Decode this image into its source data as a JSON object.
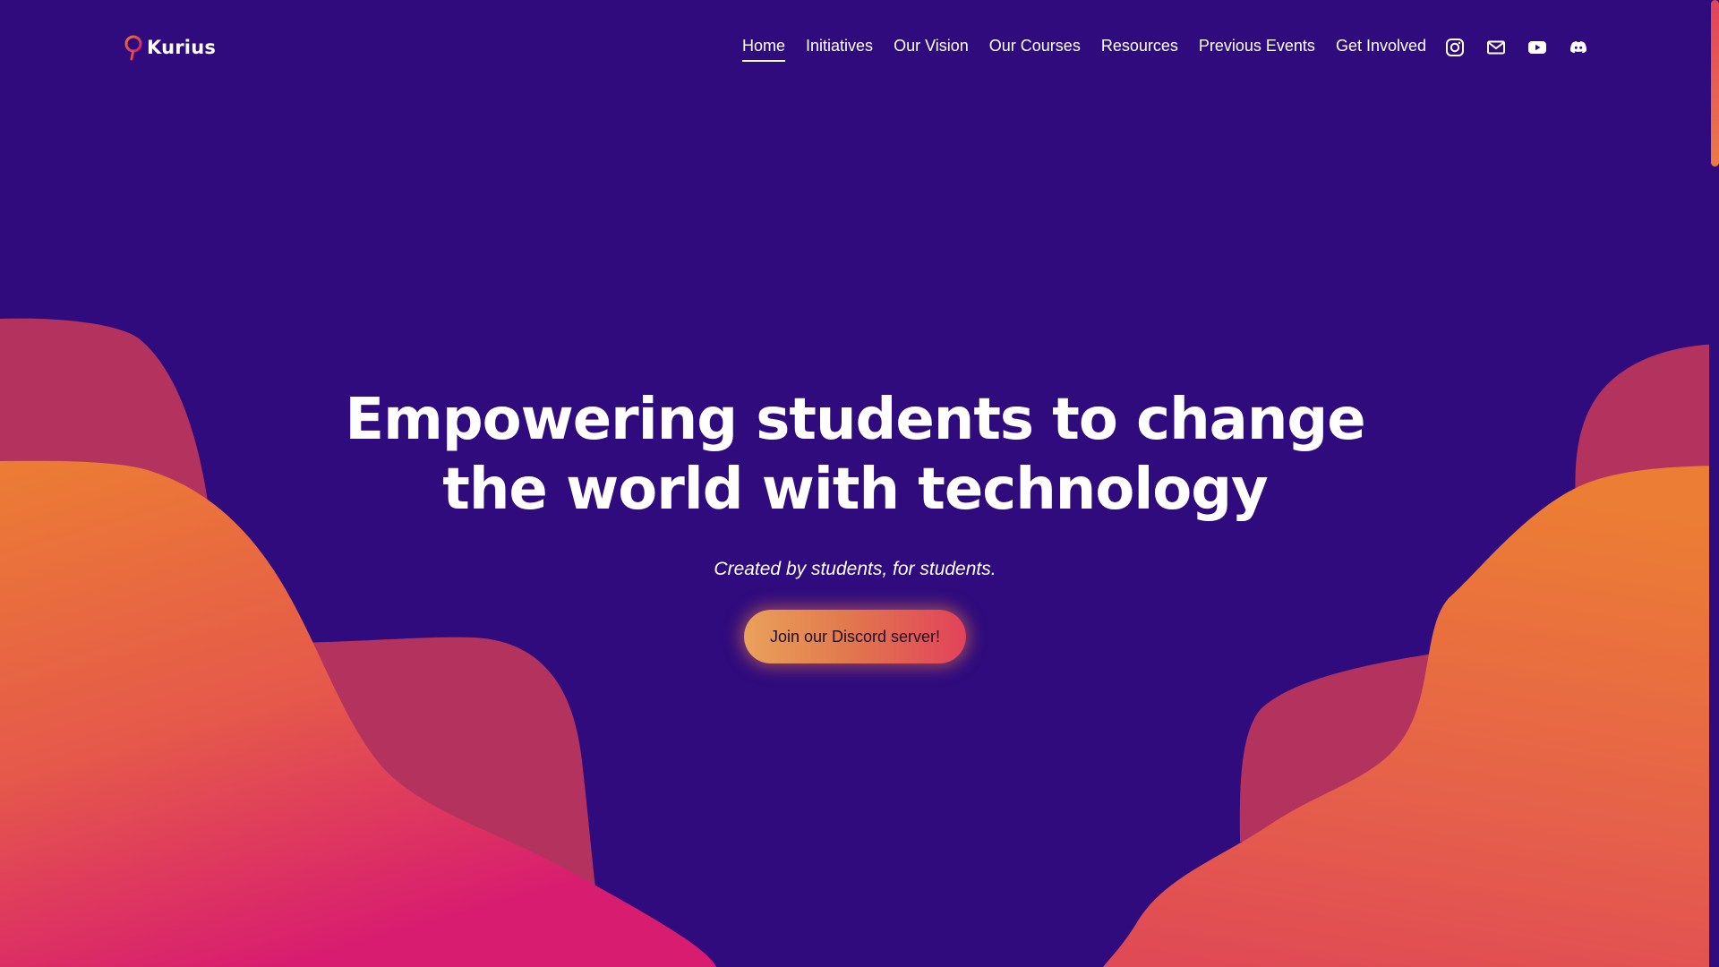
{
  "brand": {
    "name": "Kurius"
  },
  "nav": {
    "items": [
      {
        "label": "Home",
        "active": true
      },
      {
        "label": "Initiatives",
        "active": false
      },
      {
        "label": "Our Vision",
        "active": false
      },
      {
        "label": "Our Courses",
        "active": false
      },
      {
        "label": "Resources",
        "active": false
      },
      {
        "label": "Previous Events",
        "active": false
      },
      {
        "label": "Get Involved",
        "active": false
      }
    ]
  },
  "social": [
    {
      "icon": "instagram-icon"
    },
    {
      "icon": "mail-icon"
    },
    {
      "icon": "youtube-icon"
    },
    {
      "icon": "discord-icon"
    }
  ],
  "hero": {
    "title_line1": "Empowering students to change",
    "title_line2": "the world with technology",
    "subtitle": "Created by students, for students.",
    "cta_label": "Join our Discord server!"
  },
  "colors": {
    "background": "#2f0b7d",
    "accent_orange": "#eb7a37",
    "accent_pink": "#d8186e",
    "blob_back": "#b3325e"
  }
}
